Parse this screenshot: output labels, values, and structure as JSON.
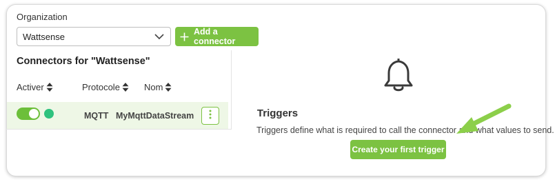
{
  "organization": {
    "label": "Organization",
    "selected": "Wattsense",
    "add_connector_label": "Add a connector"
  },
  "connectors": {
    "title": "Connectors for \"Wattsense\"",
    "columns": [
      "Activer",
      "Protocole",
      "Nom"
    ],
    "rows": [
      {
        "active": true,
        "status_color": "#2ec27e",
        "protocol": "MQTT",
        "name": "MyMqttDataStream"
      }
    ]
  },
  "triggers": {
    "icon": "bell-icon",
    "title": "Triggers",
    "description": "Triggers define what is required to call the connector and what values to send.",
    "create_label": "Create your first trigger"
  },
  "colors": {
    "accent": "#7cc242",
    "status_green": "#2ec27e",
    "row_highlight": "#eef7e6"
  }
}
